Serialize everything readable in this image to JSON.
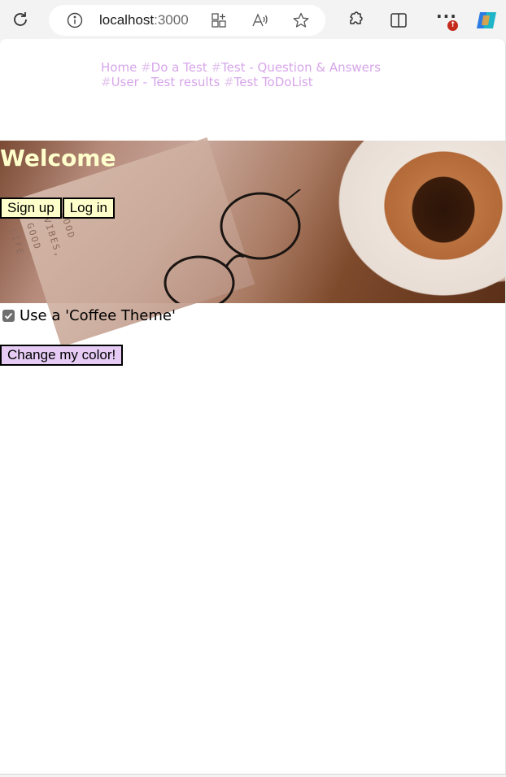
{
  "browser": {
    "url_host": "localhost",
    "url_port": ":3000",
    "notification_badge": "↑"
  },
  "nav": {
    "home": "Home",
    "links": [
      "Do a Test",
      "Test - Question & Answers",
      "User - Test results",
      "Test ToDoList"
    ],
    "separator": "#"
  },
  "hero": {
    "title": "Welcome",
    "image_text": "GOOD\nVIBES,\nGOOD\nLIFE",
    "signup_label": "Sign up",
    "login_label": "Log in"
  },
  "theme": {
    "checkbox_label": "Use a 'Coffee Theme'",
    "checked": true
  },
  "color_button_label": "Change my color!",
  "colors": {
    "nav_link": "#d7a6ea",
    "welcome_text": "#ffffcc",
    "auth_button_bg": "#ffffcc",
    "color_button_bg": "#e6ccf5",
    "badge": "#c42b1c"
  }
}
